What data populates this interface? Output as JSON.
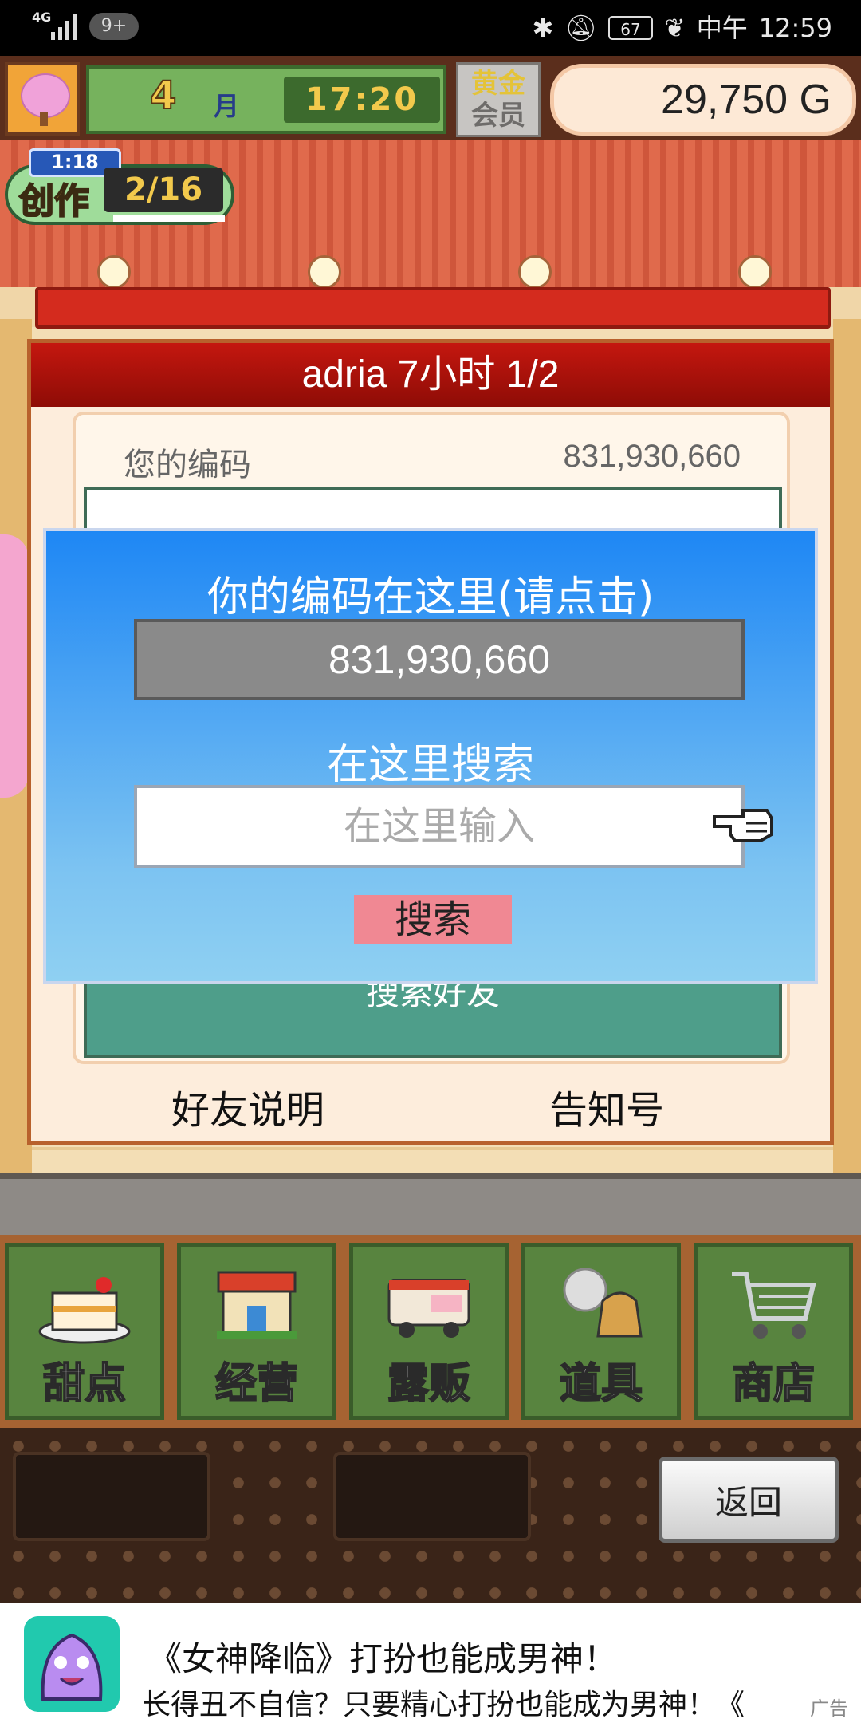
{
  "status_bar": {
    "network": "4G",
    "notification_badge": "9+",
    "battery": "67",
    "time": "12:59",
    "time_prefix": "中午"
  },
  "hud": {
    "month_number": "4",
    "month_label": "月",
    "clock": "17:20",
    "vip_line1": "黄金",
    "vip_line2": "会员",
    "gold": "29,750 G"
  },
  "create_badge": {
    "timer": "1:18",
    "label": "创作",
    "count": "2/16"
  },
  "friend_dialog": {
    "title": "adria  7小时 1/2",
    "code_label": "您的编码",
    "code_value": "831,930,660",
    "search_friend_button": "搜索好友",
    "help_link": "好友说明",
    "notice_link": "告知号"
  },
  "code_popup": {
    "title": "你的编码在这里(请点击)",
    "code": "831,930,660",
    "search_label": "在这里搜索",
    "search_placeholder": "在这里输入",
    "search_button": "搜索"
  },
  "menu": [
    {
      "label": "甜点",
      "icon": "cake-icon"
    },
    {
      "label": "经营",
      "icon": "shop-icon"
    },
    {
      "label": "露贩",
      "icon": "food-truck-icon"
    },
    {
      "label": "道具",
      "icon": "items-bag-icon"
    },
    {
      "label": "商店",
      "icon": "shopping-cart-icon"
    }
  ],
  "back_button": "返回",
  "ad": {
    "line1": "《女神降临》打扮也能成男神！",
    "line2": "长得丑不自信？只要精心打扮也能成为男神！《",
    "tag": "广告"
  }
}
